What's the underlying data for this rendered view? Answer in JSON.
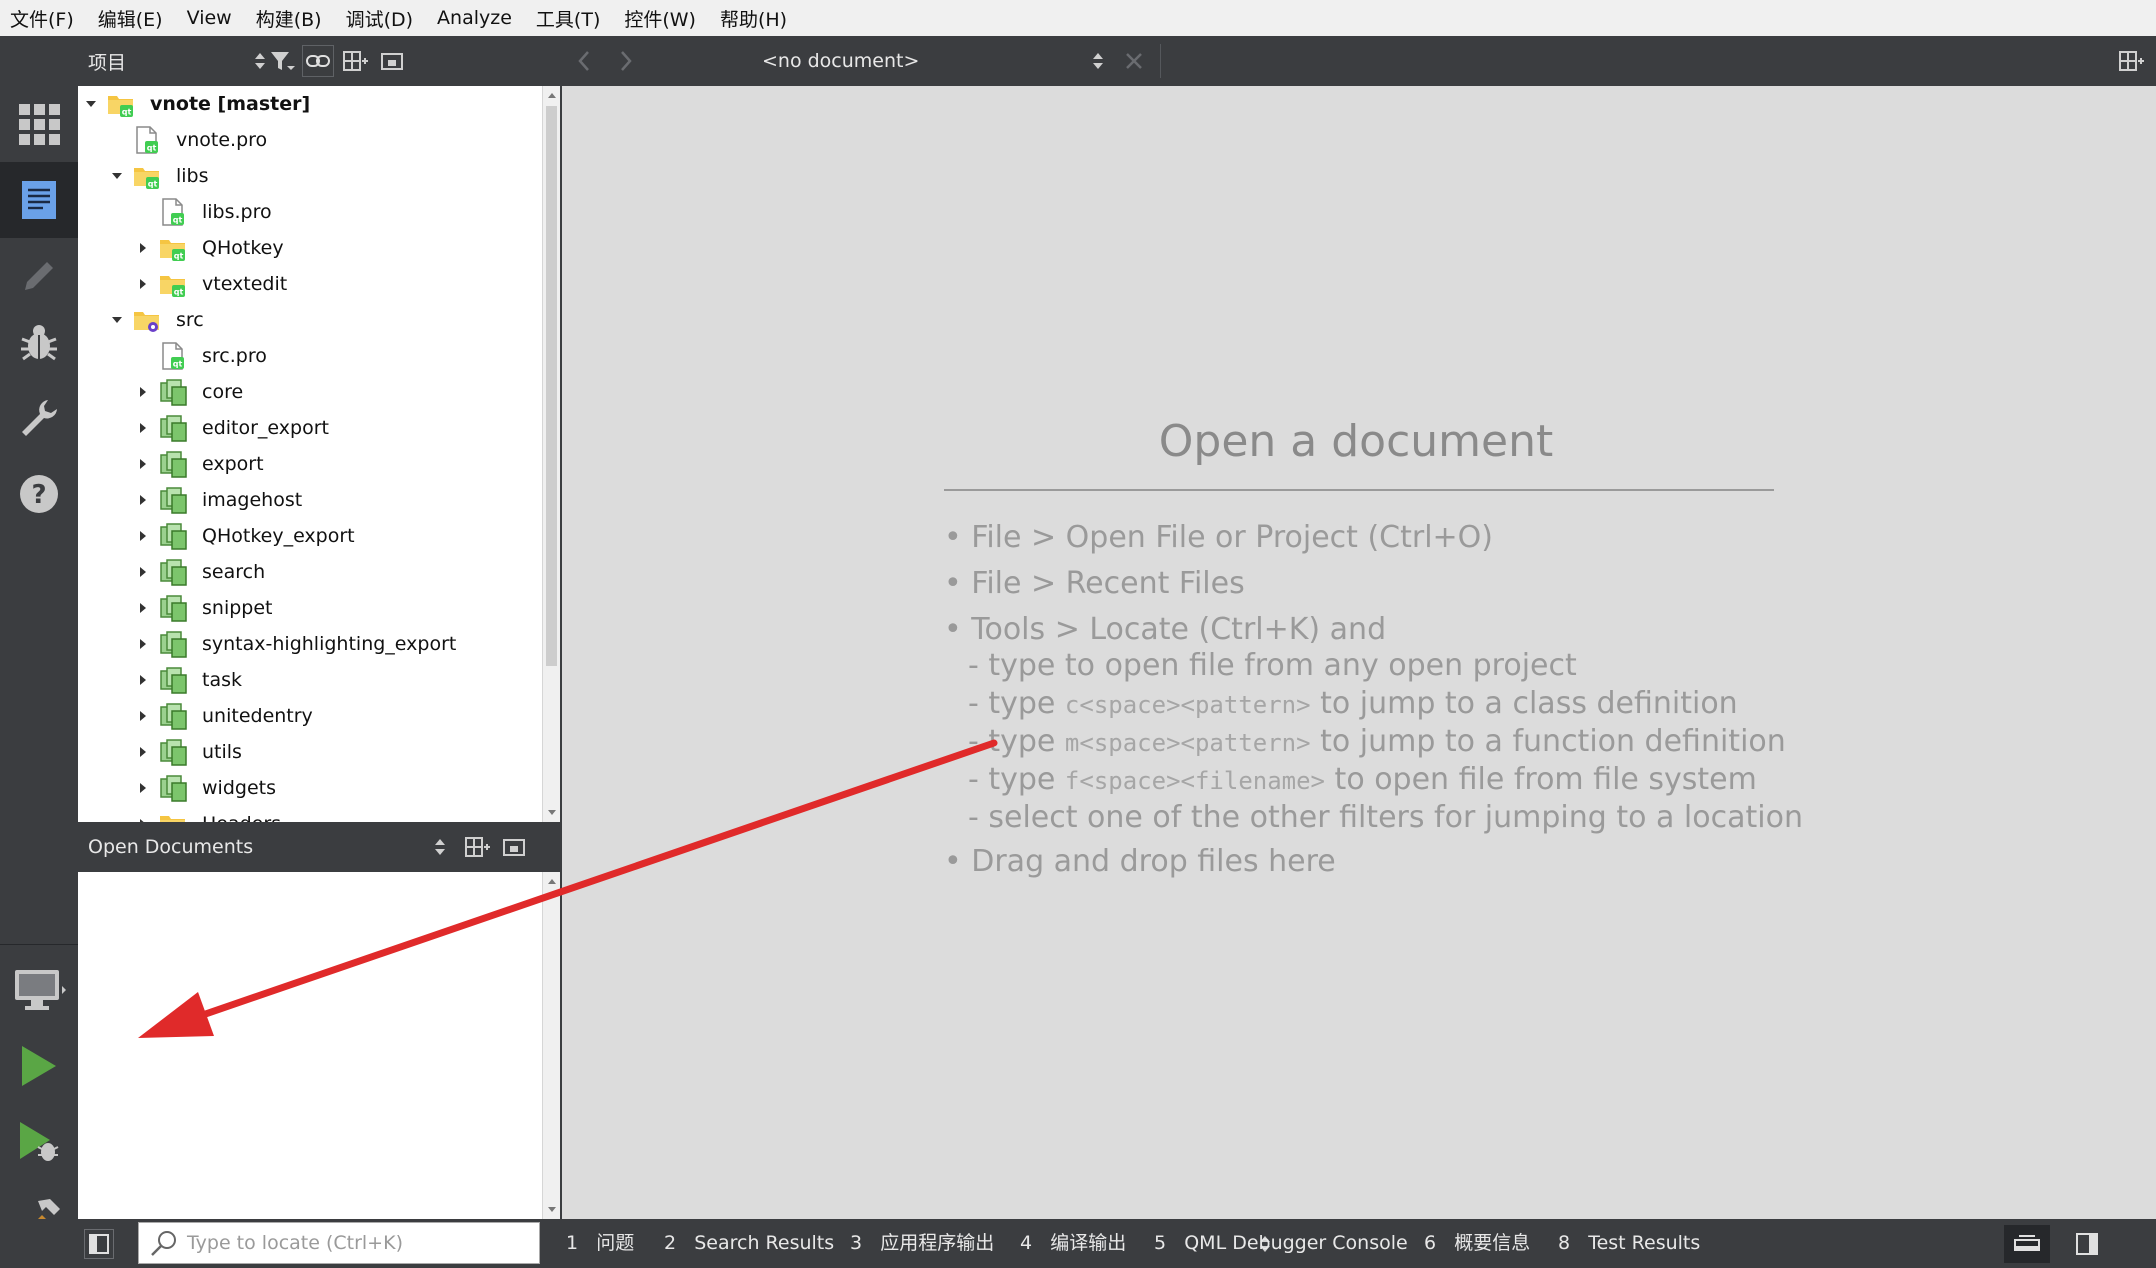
{
  "menubar": {
    "items": [
      "文件(F)",
      "编辑(E)",
      "View",
      "构建(B)",
      "调试(D)",
      "Analyze",
      "工具(T)",
      "控件(W)",
      "帮助(H)"
    ]
  },
  "projects": {
    "title": "项目",
    "tree": [
      {
        "label": "vnote [master]",
        "icon": "qt-project-folder-icon",
        "bold": true,
        "expanded": true
      },
      {
        "label": "vnote.pro",
        "icon": "qt-pro-file-icon"
      },
      {
        "label": "libs",
        "icon": "qt-project-folder-icon",
        "expanded": true
      },
      {
        "label": "libs.pro",
        "icon": "qt-pro-file-icon"
      },
      {
        "label": "QHotkey",
        "icon": "qt-project-folder-icon",
        "expanded": false
      },
      {
        "label": "vtextedit",
        "icon": "qt-project-folder-icon",
        "expanded": false
      },
      {
        "label": "src",
        "icon": "app-project-folder-icon",
        "expanded": true
      },
      {
        "label": "src.pro",
        "icon": "qt-pro-file-icon"
      },
      {
        "label": "core",
        "icon": "pri-file-icon",
        "expanded": false
      },
      {
        "label": "editor_export",
        "icon": "pri-file-icon",
        "expanded": false
      },
      {
        "label": "export",
        "icon": "pri-file-icon",
        "expanded": false
      },
      {
        "label": "imagehost",
        "icon": "pri-file-icon",
        "expanded": false
      },
      {
        "label": "QHotkey_export",
        "icon": "pri-file-icon",
        "expanded": false
      },
      {
        "label": "search",
        "icon": "pri-file-icon",
        "expanded": false
      },
      {
        "label": "snippet",
        "icon": "pri-file-icon",
        "expanded": false
      },
      {
        "label": "syntax-highlighting_export",
        "icon": "pri-file-icon",
        "expanded": false
      },
      {
        "label": "task",
        "icon": "pri-file-icon",
        "expanded": false
      },
      {
        "label": "unitedentry",
        "icon": "pri-file-icon",
        "expanded": false
      },
      {
        "label": "utils",
        "icon": "pri-file-icon",
        "expanded": false
      },
      {
        "label": "widgets",
        "icon": "pri-file-icon",
        "expanded": false
      },
      {
        "label": "Headers",
        "icon": "folder-icon",
        "expanded": false
      }
    ]
  },
  "open_documents": {
    "title": "Open Documents"
  },
  "editor": {
    "document_combo": "<no document>"
  },
  "welcome": {
    "title": "Open a document",
    "bullet": "•",
    "lines": {
      "open_file": "File > Open File or Project (Ctrl+O)",
      "recent": "File > Recent Files",
      "locate": "Tools > Locate (Ctrl+K) and",
      "sub1": "- type to open file from any open project",
      "sub2_a": "- type ",
      "sub2_code": "c<space><pattern>",
      "sub2_b": " to jump to a class definition",
      "sub3_a": "- type ",
      "sub3_code": "m<space><pattern>",
      "sub3_b": " to jump to a function definition",
      "sub4_a": "- type ",
      "sub4_code": "f<space><filename>",
      "sub4_b": " to open file from file system",
      "sub5": "- select one of the other filters for jumping to a location",
      "drag": "Drag and drop files here"
    }
  },
  "statusbar": {
    "locator_placeholder": "Type to locate (Ctrl+K)",
    "tabs": [
      {
        "num": "1",
        "label": "问题"
      },
      {
        "num": "2",
        "label": "Search Results"
      },
      {
        "num": "3",
        "label": "应用程序输出"
      },
      {
        "num": "4",
        "label": "编译输出"
      },
      {
        "num": "5",
        "label": "QML Debugger Console"
      },
      {
        "num": "6",
        "label": "概要信息"
      },
      {
        "num": "8",
        "label": "Test Results"
      }
    ]
  },
  "colors": {
    "dark_chrome": "#3b3d40",
    "welcome_bg": "#dcdcdc",
    "annotation_arrow": "#e02a2a",
    "run_green": "#5aa645",
    "qt_green": "#41cd52"
  }
}
